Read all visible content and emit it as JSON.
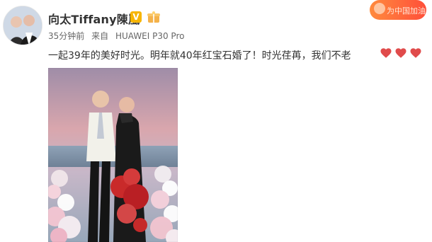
{
  "header": {
    "user_name": "向太Tiffany陳嵐",
    "verified_badge": "V",
    "rank_icon": "gift-box-icon",
    "meta": {
      "time": "35分钟前",
      "source_prefix": "来自",
      "device": "HUAWEI P30 Pro"
    }
  },
  "promo": {
    "label": "为中国加油"
  },
  "post": {
    "text": "一起39年的美好时光。明年就40年红宝石婚了！时光荏苒，我们不老",
    "emoji": [
      "heart-icon",
      "heart-icon",
      "heart-icon"
    ]
  },
  "colors": {
    "heart": "#e04b4b",
    "badge": "#f7b500",
    "promo": "#ff5a3a",
    "text": "#333333",
    "meta": "#666666"
  }
}
